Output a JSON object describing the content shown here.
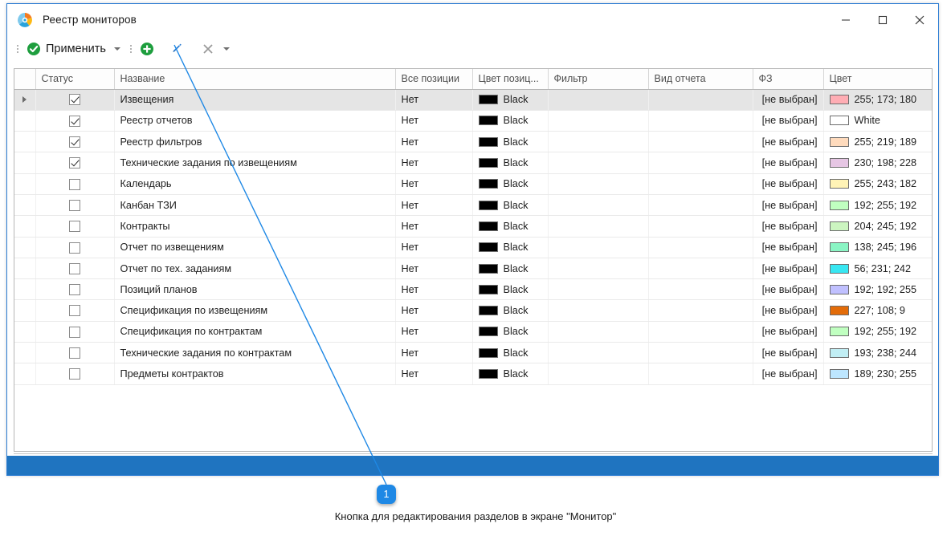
{
  "window": {
    "title": "Реестр монитopов",
    "app_icon": "app-logo-icon",
    "controls": {
      "minimize": "—",
      "maximize": "▢",
      "close": "✕"
    }
  },
  "toolbar": {
    "apply_label": "Применить",
    "apply_icon": "check-circle-icon",
    "apply_caret": "▾",
    "add_icon": "plus-circle-icon",
    "edit_icon": "pencil-icon",
    "delete_icon": "cross-icon",
    "delete_caret": "▾"
  },
  "grid": {
    "columns": [
      "",
      "Статус",
      "Название",
      "Все позиции",
      "Цвет позиц...",
      "Фильтр",
      "Вид отчета",
      "ФЗ",
      "Цвет"
    ],
    "rows": [
      {
        "selected": true,
        "checked": true,
        "name": "Извещения",
        "all_positions": "Нет",
        "pos_color_name": "Black",
        "pos_color_hex": "#000000",
        "filter": "",
        "report_kind": "",
        "fz": "[не выбран]",
        "color_label": "255; 173; 180",
        "color_hex": "#ffadb4"
      },
      {
        "selected": false,
        "checked": true,
        "name": "Реестр отчетов",
        "all_positions": "Нет",
        "pos_color_name": "Black",
        "pos_color_hex": "#000000",
        "filter": "",
        "report_kind": "",
        "fz": "[не выбран]",
        "color_label": "White",
        "color_hex": "#ffffff"
      },
      {
        "selected": false,
        "checked": true,
        "name": "Реестр фильтров",
        "all_positions": "Нет",
        "pos_color_name": "Black",
        "pos_color_hex": "#000000",
        "filter": "",
        "report_kind": "",
        "fz": "[не выбран]",
        "color_label": "255; 219; 189",
        "color_hex": "#ffdbbd"
      },
      {
        "selected": false,
        "checked": true,
        "name": "Технические задания по извещениям",
        "all_positions": "Нет",
        "pos_color_name": "Black",
        "pos_color_hex": "#000000",
        "filter": "",
        "report_kind": "",
        "fz": "[не выбран]",
        "color_label": "230; 198; 228",
        "color_hex": "#e6c6e4"
      },
      {
        "selected": false,
        "checked": false,
        "name": "Календарь",
        "all_positions": "Нет",
        "pos_color_name": "Black",
        "pos_color_hex": "#000000",
        "filter": "",
        "report_kind": "",
        "fz": "[не выбран]",
        "color_label": "255; 243; 182",
        "color_hex": "#fff3b6"
      },
      {
        "selected": false,
        "checked": false,
        "name": "Канбан ТЗИ",
        "all_positions": "Нет",
        "pos_color_name": "Black",
        "pos_color_hex": "#000000",
        "filter": "",
        "report_kind": "",
        "fz": "[не выбран]",
        "color_label": "192; 255; 192",
        "color_hex": "#c0ffc0"
      },
      {
        "selected": false,
        "checked": false,
        "name": "Контракты",
        "all_positions": "Нет",
        "pos_color_name": "Black",
        "pos_color_hex": "#000000",
        "filter": "",
        "report_kind": "",
        "fz": "[не выбран]",
        "color_label": "204; 245; 192",
        "color_hex": "#ccf5c0"
      },
      {
        "selected": false,
        "checked": false,
        "name": "Отчет по извещениям",
        "all_positions": "Нет",
        "pos_color_name": "Black",
        "pos_color_hex": "#000000",
        "filter": "",
        "report_kind": "",
        "fz": "[не выбран]",
        "color_label": "138; 245; 196",
        "color_hex": "#8af5c4"
      },
      {
        "selected": false,
        "checked": false,
        "name": "Отчет по тех. заданиям",
        "all_positions": "Нет",
        "pos_color_name": "Black",
        "pos_color_hex": "#000000",
        "filter": "",
        "report_kind": "",
        "fz": "[не выбран]",
        "color_label": "56; 231; 242",
        "color_hex": "#38e7f2"
      },
      {
        "selected": false,
        "checked": false,
        "name": "Позиций планов",
        "all_positions": "Нет",
        "pos_color_name": "Black",
        "pos_color_hex": "#000000",
        "filter": "",
        "report_kind": "",
        "fz": "[не выбран]",
        "color_label": "192; 192; 255",
        "color_hex": "#c0c0ff"
      },
      {
        "selected": false,
        "checked": false,
        "name": "Спецификация по извещениям",
        "all_positions": "Нет",
        "pos_color_name": "Black",
        "pos_color_hex": "#000000",
        "filter": "",
        "report_kind": "",
        "fz": "[не выбран]",
        "color_label": "227; 108; 9",
        "color_hex": "#e36c09"
      },
      {
        "selected": false,
        "checked": false,
        "name": "Спецификация по контрактам",
        "all_positions": "Нет",
        "pos_color_name": "Black",
        "pos_color_hex": "#000000",
        "filter": "",
        "report_kind": "",
        "fz": "[не выбран]",
        "color_label": "192; 255; 192",
        "color_hex": "#c0ffc0"
      },
      {
        "selected": false,
        "checked": false,
        "name": "Технические задания по контрактам",
        "all_positions": "Нет",
        "pos_color_name": "Black",
        "pos_color_hex": "#000000",
        "filter": "",
        "report_kind": "",
        "fz": "[не выбран]",
        "color_label": "193; 238; 244",
        "color_hex": "#c1eef4"
      },
      {
        "selected": false,
        "checked": false,
        "name": "Предметы контрактов",
        "all_positions": "Нет",
        "pos_color_name": "Black",
        "pos_color_hex": "#000000",
        "filter": "",
        "report_kind": "",
        "fz": "[не выбран]",
        "color_label": "189; 230; 255",
        "color_hex": "#bde6ff"
      }
    ]
  },
  "annotation": {
    "badge_number": "1",
    "caption": "Кнопка для редактирования разделов в экране \"Монитор\""
  },
  "colors": {
    "accent": "#1f74c0",
    "window_border": "#2b7cd3",
    "annotation": "#1e88e5",
    "apply_green": "#1e9e3e",
    "pencil_blue": "#2b7cd3"
  }
}
